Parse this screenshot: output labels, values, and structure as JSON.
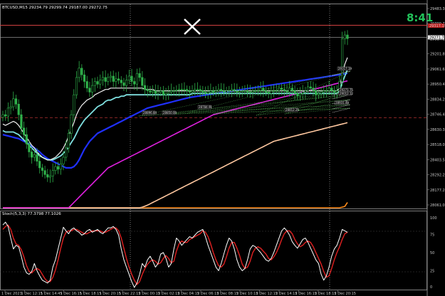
{
  "chart_header": {
    "symbol_label": "BTCUSD,M15",
    "ohlc": "29234.79 29299.74 29187.00 29272.75"
  },
  "timer": "8:41",
  "oscillator_header": "Stoch(5,3,3) 77.3798 77.1026",
  "price_tags": [
    "29317.19",
    "29271.75",
    "29012.12",
    "28931.48",
    "28896.84",
    "28850.00",
    "28784.91",
    "28812.25"
  ],
  "price_axis": [
    "29483.39",
    "29399.76",
    "29317.19",
    "29201.81",
    "29061.68",
    "28950.46",
    "28834.23",
    "28746.48",
    "28630.31",
    "28518.00",
    "28403.51",
    "28292.21",
    "28177.28",
    "28061.05"
  ],
  "osc_axis": [
    "100",
    "75",
    "50",
    "25",
    "0"
  ],
  "time_axis": [
    "1 Dec 2023",
    "1 Dec 12:15",
    "1 Dec 14:45",
    "1 Dec 16:15",
    "1 Dec 18:15",
    "1 Dec 20:15",
    "1 Dec 22:15",
    "2 Dec 00:15",
    "2 Dec 02:15",
    "2 Dec 04:15",
    "2 Dec 06:15",
    "2 Dec 08:15",
    "2 Dec 10:15",
    "2 Dec 12:15",
    "2 Dec 14:15",
    "2 Dec 16:15",
    "2 Dec 18:15",
    "2 Dec 20:15"
  ],
  "chart_data": {
    "type": "candlestick",
    "symbol": "BTCUSD",
    "timeframe": "M15",
    "ylim": [
      28000,
      29520
    ],
    "candles_close": [
      28700,
      28690,
      28750,
      28760,
      28820,
      28780,
      28700,
      28600,
      28550,
      28480,
      28420,
      28380,
      28400,
      28350,
      28300,
      28280,
      28250,
      28230,
      28240,
      28280,
      28310,
      28290,
      28330,
      28380,
      28450,
      28560,
      28700,
      28850,
      28980,
      29050,
      29000,
      28950,
      28900,
      28870,
      28920,
      28950,
      28930,
      28960,
      28980,
      28950,
      28980,
      28990,
      28950,
      28970,
      28960,
      28940,
      28920,
      28960,
      28990,
      28950,
      28930,
      29010,
      28980,
      28920,
      28890,
      28880,
      28870,
      28880,
      28860,
      28870,
      28880,
      28850,
      28860,
      28870,
      28880,
      28880,
      28885,
      28890,
      28885,
      28890,
      28880,
      28870,
      28880,
      28890,
      28890,
      28880,
      28870,
      28860,
      28870,
      28880,
      28870,
      28880,
      28890,
      28880,
      28870,
      28880,
      28880,
      28890,
      28880,
      28870,
      28880,
      28880,
      28880,
      28870,
      28870,
      28880,
      28880,
      28880,
      28900,
      28880,
      28870,
      28860,
      28880,
      28880,
      28880,
      28900,
      28890,
      28880,
      28870,
      28900,
      28880,
      28860,
      28840,
      28860,
      28870,
      28880,
      28910,
      28900,
      28880,
      28850,
      28860,
      28870,
      28880,
      28880,
      28900,
      28880,
      28870,
      28880,
      28950,
      29270,
      29300,
      29272
    ],
    "ema_fast": [
      28630,
      28620,
      28630,
      28640,
      28650,
      28640,
      28620,
      28590,
      28560,
      28530,
      28500,
      28470,
      28450,
      28420,
      28400,
      28380,
      28370,
      28360,
      28360,
      28370,
      28380,
      28400,
      28420,
      28450,
      28490,
      28540,
      28590,
      28640,
      28700,
      28740,
      28770,
      28790,
      28810,
      28820,
      28830,
      28850,
      28860,
      28870,
      28880,
      28890,
      28890,
      28900,
      28900,
      28900,
      28900,
      28900,
      28900,
      28900,
      28900,
      28900,
      28900,
      28900,
      28900,
      28900,
      28890,
      28890,
      28890,
      28890,
      28880,
      28880,
      28880,
      28880,
      28880,
      28880,
      28880,
      28880,
      28880,
      28880,
      28880,
      28880,
      28880,
      28880,
      28880,
      28880,
      28880,
      28880,
      28880,
      28880,
      28880,
      28880,
      28880,
      28880,
      28880,
      28880,
      28880,
      28880,
      28880,
      28880,
      28880,
      28880,
      28880,
      28880,
      28880,
      28880,
      28880,
      28880,
      28880,
      28880,
      28880,
      28880,
      28880,
      28880,
      28880,
      28880,
      28880,
      28880,
      28880,
      28880,
      28880,
      28880,
      28880,
      28880,
      28880,
      28880,
      28880,
      28880,
      28880,
      28880,
      28880,
      28880,
      28880,
      28880,
      28880,
      28880,
      28880,
      28880,
      28880,
      28880,
      28900,
      29000,
      29080,
      29130
    ],
    "ma_mid": [
      28580,
      28570,
      28570,
      28570,
      28570,
      28560,
      28550,
      28530,
      28510,
      28490,
      28470,
      28450,
      28430,
      28410,
      28390,
      28380,
      28370,
      28360,
      28360,
      28360,
      28370,
      28380,
      28390,
      28410,
      28430,
      28460,
      28490,
      28520,
      28560,
      28600,
      28630,
      28660,
      28680,
      28700,
      28720,
      28740,
      28760,
      28770,
      28780,
      28800,
      28810,
      28810,
      28820,
      28830,
      28830,
      28840,
      28840,
      28850,
      28850,
      28850,
      28850,
      28850,
      28850,
      28850,
      28850,
      28850,
      28850,
      28850,
      28850,
      28850,
      28850,
      28850,
      28850,
      28850,
      28850,
      28850,
      28850,
      28850,
      28850,
      28850,
      28850,
      28850,
      28860,
      28860,
      28860,
      28860,
      28860,
      28860,
      28860,
      28860,
      28860,
      28860,
      28860,
      28860,
      28860,
      28860,
      28860,
      28860,
      28860,
      28860,
      28860,
      28860,
      28860,
      28860,
      28860,
      28860,
      28860,
      28860,
      28860,
      28860,
      28860,
      28860,
      28860,
      28860,
      28860,
      28860,
      28860,
      28860,
      28860,
      28860,
      28860,
      28860,
      28860,
      28860,
      28860,
      28860,
      28860,
      28860,
      28860,
      28860,
      28860,
      28860,
      28860,
      28860,
      28860,
      28860,
      28860,
      28860,
      28880,
      28940,
      28990,
      29040
    ],
    "ma_slow": [
      28550,
      28545,
      28540,
      28535,
      28530,
      28525,
      28520,
      28510,
      28500,
      28490,
      28480,
      28465,
      28450,
      28435,
      28420,
      28400,
      28385,
      28370,
      28360,
      28350,
      28340,
      28330,
      28320,
      28310,
      28300,
      28300,
      28300,
      28310,
      28330,
      28360,
      28400,
      28440,
      28470,
      28500,
      28520,
      28540,
      28560,
      28570,
      28580,
      28590,
      28600,
      28610,
      28620,
      28630,
      28640,
      28650,
      28660,
      28670,
      28680,
      28690,
      28700,
      28710,
      28720,
      28730,
      28740,
      28750,
      28755,
      28760,
      28765,
      28770,
      28775,
      28780,
      28785,
      28790,
      28795,
      28800,
      28805,
      28810,
      28815,
      28820,
      28825,
      28830,
      28833,
      28836,
      28839,
      28842,
      28845,
      28848,
      28851,
      28854,
      28857,
      28860,
      28863,
      28866,
      28869,
      28872,
      28875,
      28878,
      28881,
      28884,
      28887,
      28890,
      28893,
      28896,
      28899,
      28902,
      28905,
      28908,
      28911,
      28914,
      28917,
      28920,
      28923,
      28926,
      28929,
      28932,
      28935,
      28938,
      28941,
      28944,
      28947,
      28950,
      28953,
      28956,
      28959,
      28962,
      28965,
      28968,
      28971,
      28974,
      28977,
      28980,
      28983,
      28986,
      28989,
      28992,
      28995,
      28998,
      29001,
      29004,
      29008,
      29012
    ],
    "ma_200": [
      28000,
      28000,
      28000,
      28000,
      28000,
      28000,
      28000,
      28000,
      28000,
      28000,
      28000,
      28000,
      28000,
      28000,
      28000,
      28000,
      28000,
      28000,
      28000,
      28000,
      28000,
      28000,
      28000,
      28000,
      28000,
      28000,
      28020,
      28040,
      28060,
      28080,
      28100,
      28120,
      28140,
      28160,
      28180,
      28200,
      28220,
      28240,
      28260,
      28280,
      28300,
      28310,
      28320,
      28330,
      28340,
      28350,
      28360,
      28370,
      28380,
      28390,
      28400,
      28410,
      28420,
      28430,
      28440,
      28450,
      28460,
      28470,
      28480,
      28490,
      28500,
      28510,
      28520,
      28530,
      28540,
      28550,
      28560,
      28570,
      28580,
      28590,
      28600,
      28610,
      28620,
      28630,
      28640,
      28650,
      28660,
      28670,
      28680,
      28690,
      28700,
      28705,
      28710,
      28715,
      28720,
      28725,
      28730,
      28735,
      28740,
      28745,
      28750,
      28755,
      28760,
      28765,
      28770,
      28775,
      28780,
      28785,
      28790,
      28795,
      28800,
      28805,
      28810,
      28815,
      28820,
      28825,
      28830,
      28835,
      28840,
      28845,
      28850,
      28855,
      28860,
      28865,
      28870,
      28875,
      28880,
      28885,
      28890,
      28895,
      28900,
      28905,
      28910,
      28915,
      28920,
      28925,
      28930,
      28935,
      28940,
      28945,
      28950,
      28955
    ],
    "ma_400": [
      28000,
      28000,
      28000,
      28000,
      28000,
      28000,
      28000,
      28000,
      28000,
      28000,
      28000,
      28000,
      28000,
      28000,
      28000,
      28000,
      28000,
      28000,
      28000,
      28000,
      28000,
      28000,
      28000,
      28000,
      28000,
      28000,
      28000,
      28000,
      28000,
      28000,
      28000,
      28000,
      28000,
      28000,
      28000,
      28000,
      28000,
      28000,
      28000,
      28000,
      28000,
      28000,
      28000,
      28000,
      28000,
      28000,
      28000,
      28000,
      28000,
      28000,
      28000,
      28000,
      28000,
      28005,
      28012,
      28020,
      28030,
      28040,
      28050,
      28060,
      28070,
      28080,
      28090,
      28100,
      28110,
      28120,
      28130,
      28140,
      28150,
      28160,
      28170,
      28180,
      28190,
      28200,
      28210,
      28220,
      28230,
      28240,
      28250,
      28260,
      28270,
      28280,
      28290,
      28300,
      28310,
      28320,
      28330,
      28340,
      28350,
      28360,
      28370,
      28380,
      28390,
      28400,
      28410,
      28420,
      28430,
      28440,
      28450,
      28460,
      28470,
      28480,
      28490,
      28500,
      28505,
      28510,
      28515,
      28520,
      28525,
      28530,
      28535,
      28540,
      28545,
      28550,
      28555,
      28560,
      28565,
      28570,
      28575,
      28580,
      28585,
      28590,
      28595,
      28600,
      28605,
      28610,
      28615,
      28620,
      28625,
      28630,
      28635,
      28640
    ],
    "ma_800": [
      28000,
      28000,
      28000,
      28000,
      28000,
      28000,
      28000,
      28000,
      28000,
      28000,
      28000,
      28000,
      28000,
      28000,
      28000,
      28000,
      28000,
      28000,
      28000,
      28000,
      28000,
      28000,
      28000,
      28000,
      28000,
      28000,
      28000,
      28000,
      28000,
      28000,
      28000,
      28000,
      28000,
      28000,
      28000,
      28000,
      28000,
      28000,
      28000,
      28000,
      28000,
      28000,
      28000,
      28000,
      28000,
      28000,
      28000,
      28000,
      28000,
      28000,
      28000,
      28000,
      28000,
      28000,
      28000,
      28000,
      28000,
      28000,
      28000,
      28000,
      28000,
      28000,
      28000,
      28000,
      28000,
      28000,
      28000,
      28000,
      28000,
      28000,
      28000,
      28000,
      28000,
      28000,
      28000,
      28000,
      28000,
      28000,
      28000,
      28000,
      28000,
      28000,
      28000,
      28000,
      28000,
      28000,
      28000,
      28000,
      28000,
      28000,
      28000,
      28000,
      28000,
      28000,
      28000,
      28000,
      28000,
      28000,
      28000,
      28000,
      28000,
      28000,
      28000,
      28000,
      28000,
      28000,
      28000,
      28000,
      28000,
      28000,
      28000,
      28000,
      28000,
      28000,
      28000,
      28000,
      28000,
      28000,
      28000,
      28000,
      28000,
      28000,
      28000,
      28000,
      28000,
      28000,
      28000,
      28000,
      28000,
      28005,
      28010,
      28040
    ],
    "stoch_k": [
      88,
      92,
      86,
      70,
      55,
      60,
      58,
      45,
      30,
      22,
      20,
      24,
      35,
      25,
      18,
      12,
      10,
      8,
      12,
      30,
      40,
      55,
      70,
      85,
      80,
      76,
      82,
      84,
      80,
      78,
      74,
      76,
      80,
      82,
      78,
      80,
      82,
      78,
      76,
      80,
      84,
      84,
      86,
      82,
      74,
      55,
      40,
      30,
      20,
      10,
      2,
      8,
      20,
      35,
      30,
      40,
      45,
      38,
      30,
      35,
      48,
      50,
      42,
      30,
      35,
      55,
      70,
      66,
      60,
      64,
      68,
      72,
      70,
      74,
      78,
      80,
      82,
      72,
      60,
      50,
      40,
      30,
      25,
      35,
      48,
      60,
      70,
      66,
      55,
      40,
      30,
      25,
      28,
      40,
      55,
      60,
      58,
      54,
      50,
      45,
      40,
      38,
      42,
      50,
      60,
      70,
      80,
      84,
      80,
      74,
      65,
      60,
      56,
      62,
      68,
      70,
      64,
      56,
      48,
      40,
      35,
      20,
      12,
      18,
      30,
      45,
      55,
      60,
      70,
      82,
      80,
      78
    ],
    "stoch_d": [
      82,
      86,
      88,
      82,
      70,
      62,
      60,
      54,
      44,
      32,
      24,
      22,
      26,
      28,
      26,
      20,
      14,
      10,
      10,
      16,
      26,
      40,
      56,
      70,
      78,
      80,
      80,
      82,
      82,
      80,
      78,
      76,
      76,
      78,
      80,
      80,
      80,
      80,
      78,
      78,
      80,
      82,
      84,
      84,
      80,
      70,
      56,
      42,
      30,
      20,
      12,
      6,
      10,
      20,
      28,
      34,
      38,
      40,
      38,
      34,
      36,
      42,
      46,
      42,
      36,
      38,
      52,
      62,
      66,
      64,
      64,
      68,
      70,
      72,
      74,
      76,
      80,
      78,
      72,
      62,
      50,
      40,
      32,
      30,
      34,
      44,
      56,
      64,
      64,
      56,
      46,
      34,
      28,
      30,
      38,
      50,
      56,
      58,
      56,
      52,
      48,
      42,
      40,
      44,
      50,
      58,
      68,
      76,
      80,
      80,
      76,
      68,
      62,
      58,
      60,
      64,
      66,
      64,
      58,
      50,
      42,
      34,
      24,
      16,
      18,
      28,
      40,
      50,
      58,
      68,
      76,
      78
    ]
  }
}
